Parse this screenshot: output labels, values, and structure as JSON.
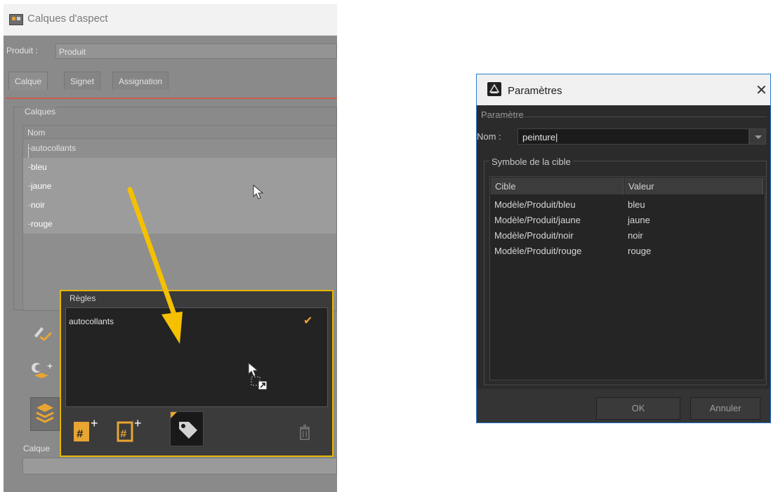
{
  "left_window": {
    "title": "Calques d'aspect",
    "produit_label": "Produit :",
    "produit_value": "Produit",
    "tabs": [
      "Calque",
      "Signet",
      "Assignation"
    ],
    "calques_group": "Calques",
    "column_name": "Nom",
    "layers": [
      "autocollants",
      "bleu",
      "jaune",
      "noir",
      "rouge"
    ],
    "calque_bottom_label": "Calque",
    "regles": {
      "label": "Règles",
      "item": "autocollants",
      "check": "✔"
    }
  },
  "dialog": {
    "title": "Paramètres",
    "close": "✕",
    "group_label": "Paramètre",
    "nom_label": "Nom :",
    "nom_value": "peinture|",
    "symbole_label": "Symbole de la cible",
    "columns": [
      "Cible",
      "Valeur"
    ],
    "rows": [
      {
        "cible": "Modèle/Produit/bleu",
        "valeur": "bleu"
      },
      {
        "cible": "Modèle/Produit/jaune",
        "valeur": "jaune"
      },
      {
        "cible": "Modèle/Produit/noir",
        "valeur": "noir"
      },
      {
        "cible": "Modèle/Produit/rouge",
        "valeur": "rouge"
      }
    ],
    "ok_label": "OK",
    "cancel_label": "Annuler"
  },
  "colors": {
    "highlight": "#e7b600",
    "accent_orange": "#e8a532",
    "tab_underline": "#c75b4a",
    "dialog_border": "#2b7bd0"
  },
  "icons": [
    "app-icon",
    "edit-layer-icon",
    "add-layer-icon",
    "layers-stack-icon",
    "add-rule-icon",
    "add-rule-outline-icon",
    "tag-icon",
    "trash-icon",
    "mouse-cursor-icon",
    "drag-shortcut-cursor-icon",
    "arrow-icon",
    "close-icon",
    "dialog-app-icon"
  ]
}
